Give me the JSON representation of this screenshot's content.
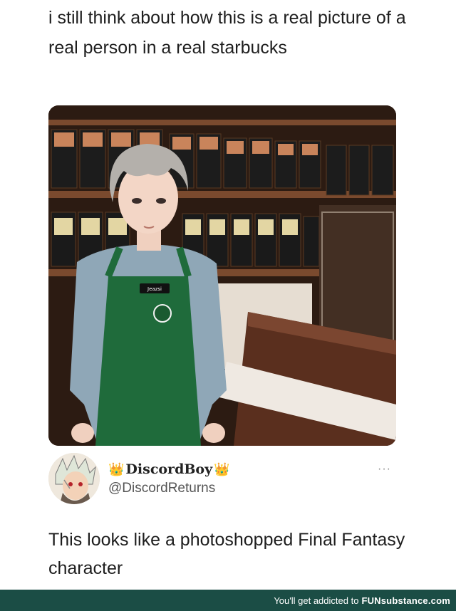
{
  "post": {
    "caption": "i still think about how this is a real picture of a real person in a real starbucks"
  },
  "photo": {
    "name_tag": "Jeazsi"
  },
  "reply": {
    "display_name": "DiscordBoy",
    "crown_left": "👑",
    "crown_right": "👑",
    "handle": "@DiscordReturns",
    "more": "···",
    "text": "This looks like a photoshopped Final Fantasy character"
  },
  "footer": {
    "tagline": "You'll get addicted to",
    "brand": "FUNsubstance.com"
  },
  "colors": {
    "apron": "#1f6b3b",
    "footer_bg": "#1b4d45",
    "wood": "#5a2f1e"
  }
}
